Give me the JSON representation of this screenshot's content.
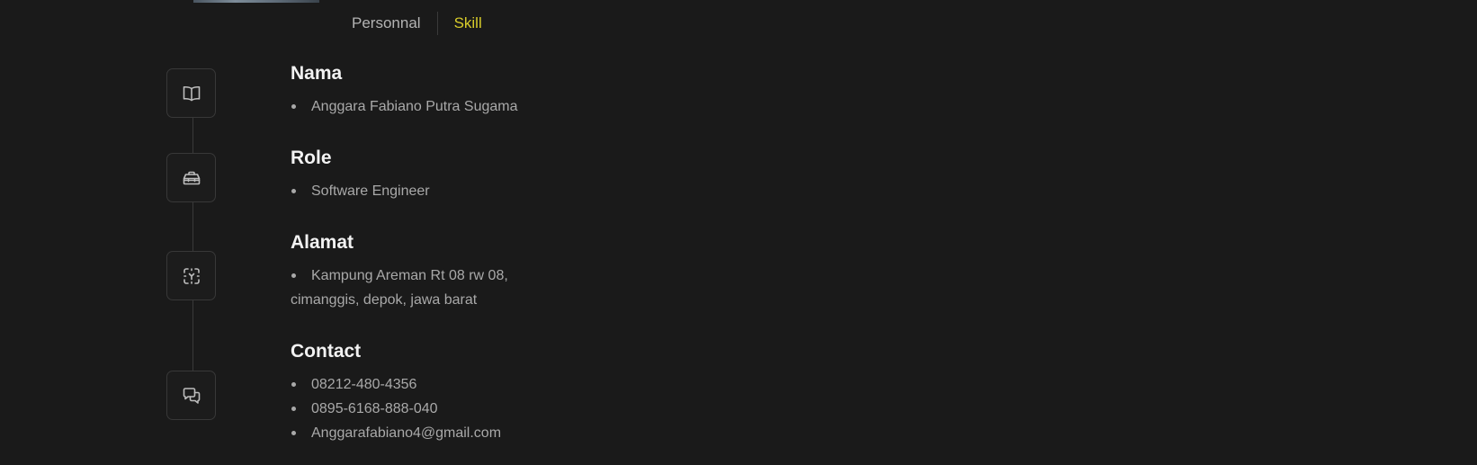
{
  "tabs": {
    "personal": "Personnal",
    "skill": "Skill",
    "active": "Skill",
    "active_color": "#d8cc2a"
  },
  "sections": [
    {
      "icon": "book-icon",
      "title": "Nama",
      "items": [
        "Anggara Fabiano Putra Sugama"
      ]
    },
    {
      "icon": "toolbox-icon",
      "title": "Role",
      "items": [
        "Software Engineer"
      ]
    },
    {
      "icon": "location-scan-icon",
      "title": "Alamat",
      "items": [
        "Kampung Areman Rt 08 rw 08,",
        "cimanggis, depok, jawa barat"
      ]
    },
    {
      "icon": "chat-bubbles-icon",
      "title": "Contact",
      "items": [
        "08212-480-4356",
        "0895-6168-888-040",
        "Anggarafabiano4@gmail.com"
      ]
    }
  ]
}
